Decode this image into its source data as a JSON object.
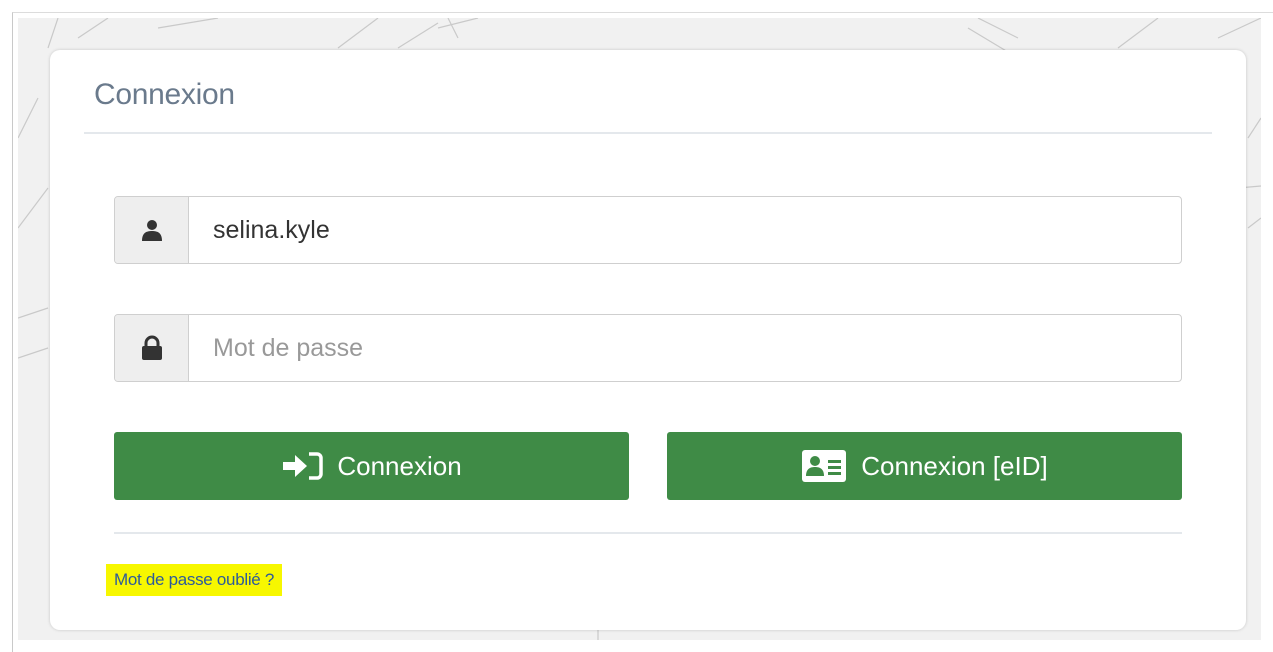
{
  "login": {
    "title": "Connexion",
    "username": {
      "value": "selina.kyle",
      "icon": "user-icon"
    },
    "password": {
      "value": "",
      "placeholder": "Mot de passe",
      "icon": "lock-icon"
    },
    "buttons": {
      "login_label": "Connexion",
      "login_icon": "sign-in-icon",
      "eid_label": "Connexion [eID]",
      "eid_icon": "id-card-icon"
    },
    "forgot_password": "Mot de passe oublié ?"
  },
  "colors": {
    "button_green": "#3f8b46",
    "title_color": "#6a7a8c",
    "highlight_yellow": "#f7f700",
    "link_blue": "#2d5b9a"
  }
}
